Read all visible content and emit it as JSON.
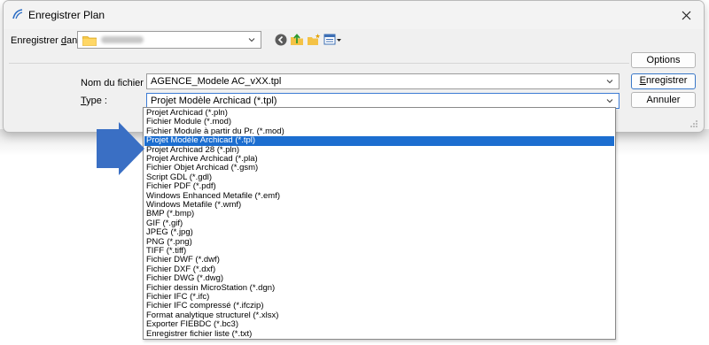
{
  "window": {
    "title": "Enregistrer Plan",
    "close_glyph": "✕"
  },
  "save_in": {
    "label_pre": "Enregistrer ",
    "label_ul": "d",
    "label_post": "ans :",
    "folder_icon": "folder-icon"
  },
  "toolbar": {
    "icons": [
      "back-icon",
      "up-folder-icon",
      "new-folder-icon",
      "view-menu-icon"
    ]
  },
  "buttons": {
    "options": "Options",
    "save_ul": "E",
    "save_rest": "nregistrer",
    "cancel": "Annuler"
  },
  "filename": {
    "label": "Nom du fichier :",
    "value": "AGENCE_Modele AC_vXX.tpl"
  },
  "type": {
    "label_ul": "T",
    "label_rest": "ype :",
    "value": "Projet Modèle Archicad (*.tpl)"
  },
  "dropdown": {
    "selected_index": 3,
    "options": [
      "Projet Archicad (*.pln)",
      "Fichier Module (*.mod)",
      "Fichier Module à partir du Pr. (*.mod)",
      "Projet Modèle Archicad (*.tpl)",
      "Projet Archicad 28 (*.pln)",
      "Projet Archive Archicad (*.pla)",
      "Fichier Objet Archicad (*.gsm)",
      "Script GDL (*.gdl)",
      "Fichier PDF (*.pdf)",
      "Windows Enhanced Metafile (*.emf)",
      "Windows Metafile (*.wmf)",
      "BMP (*.bmp)",
      "GIF (*.gif)",
      "JPEG (*.jpg)",
      "PNG (*.png)",
      "TIFF (*.tiff)",
      "Fichier DWF (*.dwf)",
      "Fichier DXF (*.dxf)",
      "Fichier DWG (*.dwg)",
      "Fichier dessin MicroStation (*.dgn)",
      "Fichier IFC (*.ifc)",
      "Fichier IFC compressé (*.ifczip)",
      "Format analytique structurel (*.xlsx)",
      "Exporter FIEBDC (*.bc3)",
      "Enregistrer fichier liste (*.txt)"
    ]
  },
  "annotation": {
    "arrow_color": "#3a6fc4"
  },
  "colors": {
    "accent": "#1c6ed0",
    "dialog_bg": "#f0f0f0"
  }
}
